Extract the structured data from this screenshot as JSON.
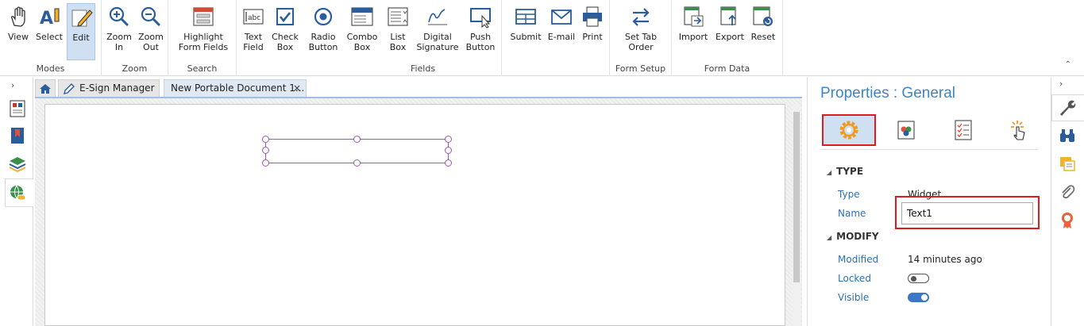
{
  "ribbon": {
    "groups": {
      "modes": "Modes",
      "zoom": "Zoom",
      "search": "Search",
      "fields": "Fields",
      "form_setup": "Form Setup",
      "form_data": "Form Data"
    },
    "buttons": {
      "view": "View",
      "select": "Select",
      "edit": "Edit",
      "zoom_in": "Zoom\nIn",
      "zoom_out": "Zoom\nOut",
      "highlight": "Highlight\nForm Fields",
      "text_field": "Text\nField",
      "check_box": "Check\nBox",
      "radio_button": "Radio\nButton",
      "combo_box": "Combo\nBox",
      "list_box": "List\nBox",
      "digital_signature": "Digital\nSignature",
      "push_button": "Push\nButton",
      "submit": "Submit",
      "email": "E-mail",
      "print": "Print",
      "set_tab_order": "Set Tab\nOrder",
      "import": "Import",
      "export": "Export",
      "reset": "Reset"
    }
  },
  "tabs": [
    {
      "label": "E-Sign Manager"
    },
    {
      "label": "New Portable Document 1..."
    }
  ],
  "properties": {
    "title": "Properties : General",
    "sections": {
      "type": "TYPE",
      "modify": "MODIFY"
    },
    "fields": {
      "type_label": "Type",
      "type_value": "Widget",
      "name_label": "Name",
      "name_value": "Text1",
      "modified_label": "Modified",
      "modified_value": "14 minutes ago",
      "locked_label": "Locked",
      "locked": false,
      "visible_label": "Visible",
      "visible": true
    }
  },
  "colors": {
    "accent": "#3b86c5",
    "highlight_border": "#e01b1b",
    "selection": "#9b59b6",
    "active_button_bg": "#cfe0f3"
  }
}
